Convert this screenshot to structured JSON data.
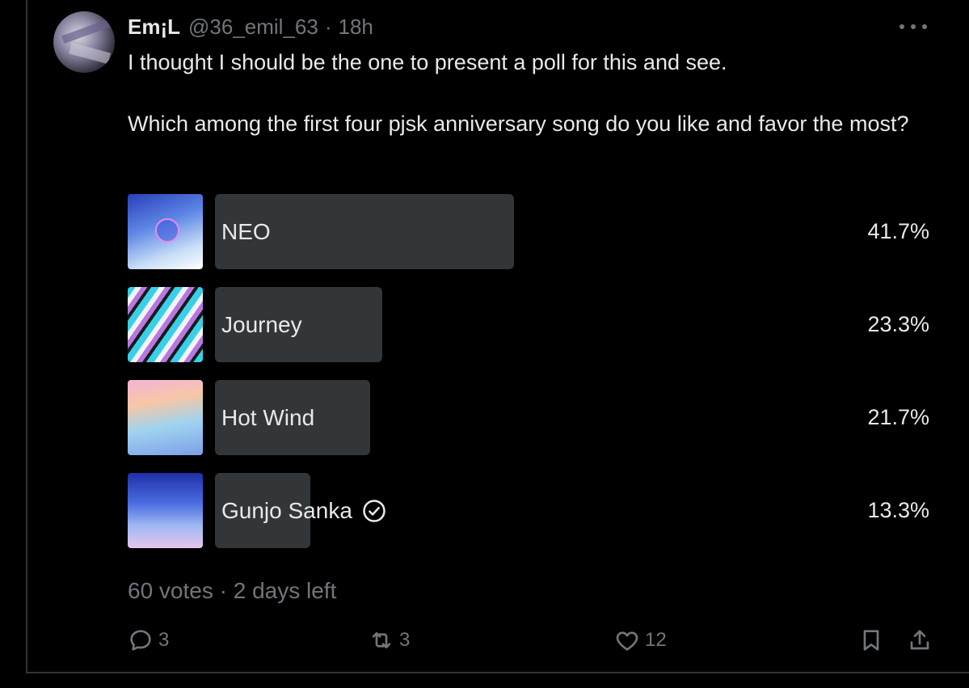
{
  "post": {
    "author_name": "Em¡L",
    "handle": "@36_emil_63",
    "separator": "·",
    "time": "18h",
    "text_lines": [
      "I thought I should be the one to present a poll for this and see.",
      "Which among the first four pjsk anniversary song do you like and favor the most?"
    ]
  },
  "poll": {
    "options": [
      {
        "label": "NEO",
        "percent_text": "41.7%",
        "percent": 41.7,
        "thumb_icon": "neo-cover-art",
        "voted": false
      },
      {
        "label": "Journey",
        "percent_text": "23.3%",
        "percent": 23.3,
        "thumb_icon": "journey-cover-art",
        "voted": false
      },
      {
        "label": "Hot Wind",
        "percent_text": "21.7%",
        "percent": 21.7,
        "thumb_icon": "hot-wind-cover-art",
        "voted": false
      },
      {
        "label": "Gunjo Sanka",
        "percent_text": "13.3%",
        "percent": 13.3,
        "thumb_icon": "gunjo-sanka-cover-art",
        "voted": true
      }
    ],
    "footer": "60 votes · 2 days left"
  },
  "actions": {
    "reply": {
      "icon": "reply-icon",
      "count": "3"
    },
    "retweet": {
      "icon": "retweet-icon",
      "count": "3"
    },
    "like": {
      "icon": "heart-icon",
      "count": "12"
    },
    "bookmark": {
      "icon": "bookmark-icon"
    },
    "share": {
      "icon": "share-icon"
    }
  },
  "colors": {
    "background": "#000000",
    "text_primary": "#e7e9ea",
    "text_secondary": "#71767b",
    "poll_bar": "#333639",
    "border": "#2f3336"
  }
}
